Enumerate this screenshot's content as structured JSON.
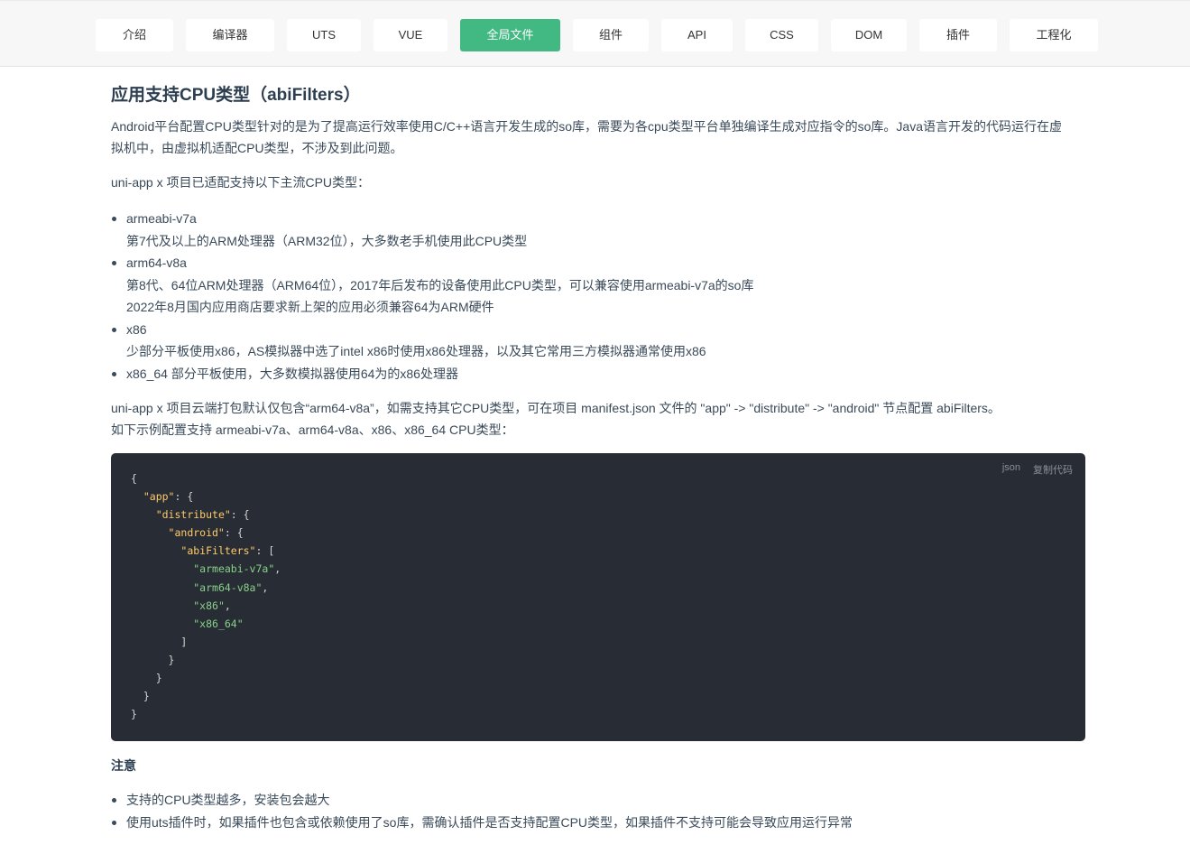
{
  "nav": {
    "tabs": [
      {
        "label": "介绍",
        "active": false
      },
      {
        "label": "编译器",
        "active": false
      },
      {
        "label": "UTS",
        "active": false
      },
      {
        "label": "VUE",
        "active": false
      },
      {
        "label": "全局文件",
        "active": true
      },
      {
        "label": "组件",
        "active": false
      },
      {
        "label": "API",
        "active": false
      },
      {
        "label": "CSS",
        "active": false
      },
      {
        "label": "DOM",
        "active": false
      },
      {
        "label": "插件",
        "active": false
      },
      {
        "label": "工程化",
        "active": false
      }
    ]
  },
  "article": {
    "title": "应用支持CPU类型（abiFilters）",
    "intro_1": "Android平台配置CPU类型针对的是为了提高运行效率使用C/C++语言开发生成的so库，需要为各cpu类型平台单独编译生成对应指令的so库。Java语言开发的代码运行在虚",
    "intro_2": "拟机中，由虚拟机适配CPU类型，不涉及到此问题。",
    "supported_intro": "uni-app x 项目已适配支持以下主流CPU类型：",
    "cpu_list": [
      {
        "name": "armeabi-v7a",
        "lines": [
          "第7代及以上的ARM处理器（ARM32位），大多数老手机使用此CPU类型"
        ]
      },
      {
        "name": "arm64-v8a",
        "lines": [
          "第8代、64位ARM处理器（ARM64位），2017年后发布的设备使用此CPU类型，可以兼容使用armeabi-v7a的so库",
          "2022年8月国内应用商店要求新上架的应用必须兼容64为ARM硬件"
        ]
      },
      {
        "name": "x86",
        "lines": [
          "少部分平板使用x86，AS模拟器中选了intel x86时使用x86处理器，以及其它常用三方模拟器通常使用x86"
        ]
      },
      {
        "name": "x86_64 部分平板使用，大多数模拟器使用64为的x86处理器",
        "lines": []
      }
    ],
    "default_1": "uni-app x 项目云端打包默认仅包含“arm64-v8a”，如需支持其它CPU类型，可在项目 manifest.json 文件的 \"app\" -> \"distribute\" -> \"android\" 节点配置 abiFilters。",
    "default_2": "如下示例配置支持 armeabi-v7a、arm64-v8a、x86、x86_64 CPU类型：",
    "code": {
      "lang": "json",
      "copy_label": "复制代码",
      "open_brace": "{",
      "key_app": "\"app\"",
      "key_distribute": "\"distribute\"",
      "key_android": "\"android\"",
      "key_abi": "\"abiFilters\"",
      "values": [
        "\"armeabi-v7a\"",
        "\"arm64-v8a\"",
        "\"x86\"",
        "\"x86_64\""
      ],
      "colon_brace": ": {",
      "colon_bracket": ": [",
      "comma": ",",
      "close_bracket": "]",
      "close_brace": "}"
    },
    "note_title": "注意",
    "notes": [
      "支持的CPU类型越多，安装包会越大",
      "使用uts插件时，如果插件也包含或依赖使用了so库，需确认插件是否支持配置CPU类型，如果插件不支持可能会导致应用运行异常"
    ]
  }
}
